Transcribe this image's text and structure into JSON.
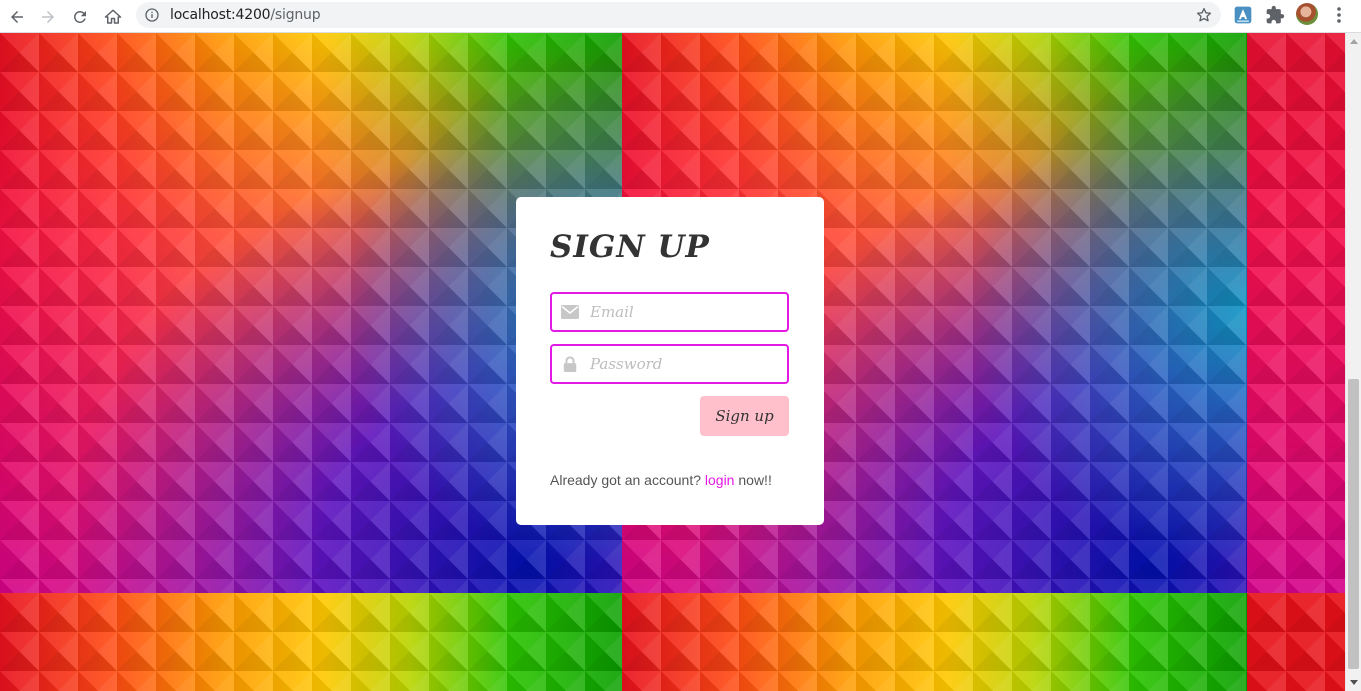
{
  "browser": {
    "url_host": "localhost:4200",
    "url_path": "/signup"
  },
  "icons": {
    "back": "arrow-left-icon",
    "forward": "arrow-right-icon",
    "reload": "reload-icon",
    "home": "home-icon",
    "info": "info-icon",
    "bookmark": "star-icon",
    "extension_app": "app-extension-icon",
    "extensions": "puzzle-icon",
    "profile": "avatar",
    "menu": "more-vert-icon",
    "email": "envelope-icon",
    "password": "lock-icon"
  },
  "signup": {
    "title": "SIGN UP",
    "email_placeholder": "Email",
    "password_placeholder": "Password",
    "submit_label": "Sign up",
    "footer_prefix": "Already got an account?",
    "footer_link": "login",
    "footer_suffix": "now!!"
  },
  "colors": {
    "accent_border": "#e519e5",
    "button_bg": "#ffc0cb",
    "link": "#e519e5",
    "card_bg": "#ffffff"
  }
}
